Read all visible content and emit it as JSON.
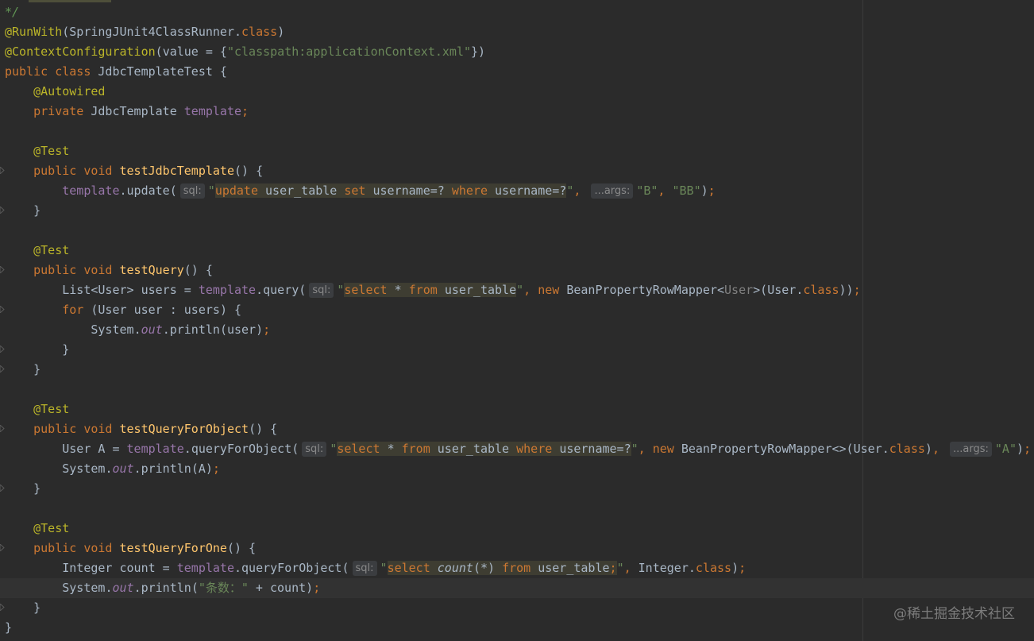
{
  "editor": {
    "comment_end": "*/",
    "watermark": "@稀土掘金技术社区",
    "kw": {
      "public": "public",
      "class": "class",
      "private": "private",
      "void": "void",
      "for": "for",
      "new": "new",
      "class_literal": "class"
    },
    "annotations": {
      "run_with": "@RunWith",
      "context_config": "@ContextConfiguration",
      "autowired": "@Autowired",
      "test": "@Test"
    },
    "types": {
      "spring_runner": "SpringJUnit4ClassRunner",
      "jdbc_template": "JdbcTemplate",
      "test_class": "JdbcTemplateTest",
      "list": "List",
      "user": "User",
      "system": "System",
      "row_mapper": "BeanPropertyRowMapper",
      "integer": "Integer"
    },
    "members": {
      "template": "template",
      "out": "out",
      "update": "update",
      "query": "query",
      "query_for_object": "queryForObject",
      "println": "println",
      "value_attr": "value"
    },
    "methods": {
      "test_jdbc_template": "testJdbcTemplate",
      "test_query": "testQuery",
      "test_query_for_object": "testQueryForObject",
      "test_query_for_one": "testQueryForOne"
    },
    "vars": {
      "users": "users",
      "user": "user",
      "a": "A",
      "count": "count"
    },
    "strings": {
      "classpath": "\"classpath:applicationContext.xml\"",
      "b": "\"B\"",
      "bb": "\"BB\"",
      "a": "\"A\"",
      "count_label": "\"条数：\""
    },
    "sql": {
      "update": "update",
      "set": "set",
      "where": "where",
      "select": "select",
      "from": "from",
      "star": "*",
      "count_fn": "count",
      "count_arg": "(*)",
      "user_table": "user_table",
      "username_eq": "username=?",
      "quote": "\"",
      "semicolon": ";"
    },
    "hints": {
      "sql": "sql:",
      "args": "...args:"
    }
  }
}
